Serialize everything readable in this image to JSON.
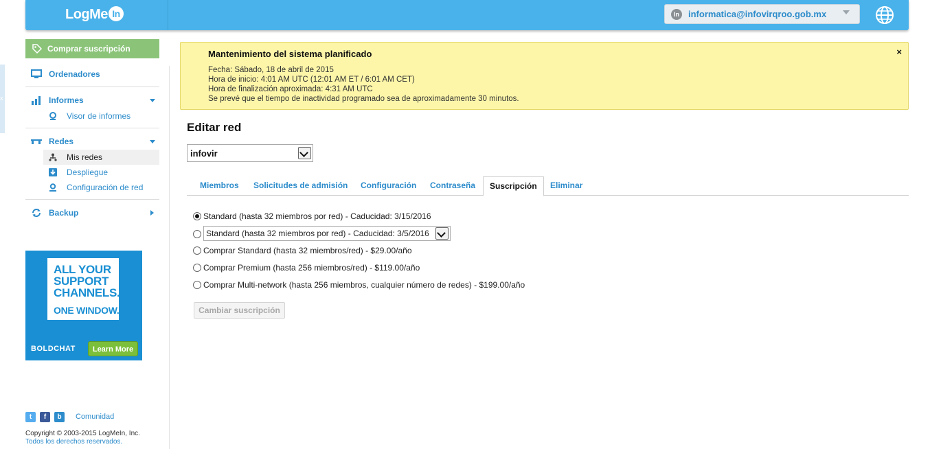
{
  "header": {
    "logo": "LogMe",
    "logo_in": "In",
    "account_badge": "In",
    "account_email": "informatica@infovirqroo.gob.mx"
  },
  "edge_tab": {
    "glyph": "x"
  },
  "sidebar": {
    "buy_label": "Comprar suscripción",
    "items": [
      {
        "label": "Ordenadores",
        "icon": "monitor-icon"
      },
      {
        "label": "Informes",
        "icon": "bar-chart-icon",
        "subitems": [
          {
            "label": "Visor de informes",
            "icon": "report-viewer-icon"
          }
        ]
      },
      {
        "label": "Redes",
        "icon": "network-icon",
        "subitems": [
          {
            "label": "Mis redes",
            "icon": "my-networks-icon",
            "active": true
          },
          {
            "label": "Despliegue",
            "icon": "deploy-icon"
          },
          {
            "label": "Configuración de red",
            "icon": "network-config-icon"
          }
        ]
      },
      {
        "label": "Backup",
        "icon": "backup-icon"
      }
    ]
  },
  "ad": {
    "line1": "ALL YOUR SUPPORT CHANNELS.",
    "line2": "ONE WINDOW.",
    "brand": "BOLDCHAT",
    "cta": "Learn More"
  },
  "footer": {
    "community": "Comunidad",
    "social": [
      "t",
      "f",
      "b"
    ],
    "copyright": "Copyright © 2003-2015 LogMeIn, Inc.",
    "rights": "Todos los derechos reservados."
  },
  "notice": {
    "title": "Mantenimiento del sistema planificado",
    "lines": [
      "Fecha: Sábado, 18 de abril de 2015",
      "Hora de inicio: 4:01 AM UTC (12:01 AM ET / 6:01 AM CET)",
      "Hora de finalización aproximada: 4:31 AM UTC",
      "Se prevé que el tiempo de inactividad programado sea de aproximadamente 30 minutos."
    ],
    "close": "×"
  },
  "main": {
    "title": "Editar red",
    "network_selected": "infovir",
    "tabs": [
      "Miembros",
      "Solicitudes de admisión",
      "Configuración",
      "Contraseña",
      "Suscripción",
      "Eliminar"
    ],
    "active_tab": "Suscripción",
    "options": [
      "Standard (hasta 32 miembros por red) - Caducidad: 3/15/2016",
      "Standard (hasta 32 miembros por red) - Caducidad: 3/5/2016",
      "Comprar Standard (hasta 32 miembros/red) - $29.00/año",
      "Comprar Premium (hasta 256 miembros/red) - $119.00/año",
      "Comprar Multi-network (hasta 256 miembros, cualquier número de redes) - $199.00/año"
    ],
    "selected_option": 0,
    "change_button": "Cambiar suscripción"
  },
  "colors": {
    "brand": "#4ab2ea",
    "link": "#2d8ccb",
    "notice_bg": "#fdf6a9",
    "buy_green": "#8bc479"
  }
}
